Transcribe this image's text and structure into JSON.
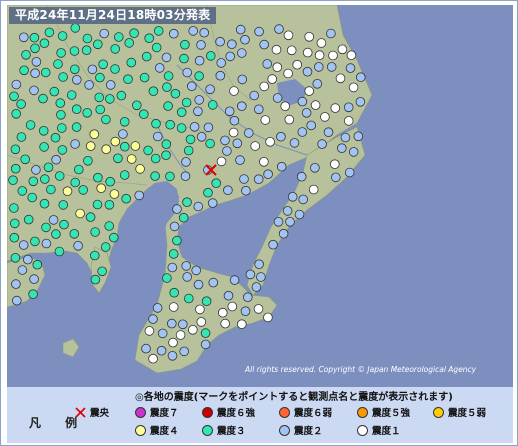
{
  "title": "平成24年11月24日18時03分発表",
  "copyright": "All rights reserved. Copyright © Japan Meteorological Agency",
  "legend": {
    "label": "凡 例",
    "heading": "◎各地の震度(マークをポイントすると観測点名と震度が表示されます)",
    "epicenter": "震央",
    "items": [
      {
        "label": "震度７",
        "color": "#cc33cc"
      },
      {
        "label": "震度６強",
        "color": "#cc0000"
      },
      {
        "label": "震度６弱",
        "color": "#ff6633"
      },
      {
        "label": "震度５強",
        "color": "#ff9900"
      },
      {
        "label": "震度５弱",
        "color": "#ffcc00"
      },
      {
        "label": "震度４",
        "color": "#ffff99"
      },
      {
        "label": "震度３",
        "color": "#33e6b3"
      },
      {
        "label": "震度２",
        "color": "#a3c4f3"
      },
      {
        "label": "震度１",
        "color": "#ffffff"
      }
    ]
  },
  "colors": {
    "sea": "#7c8fbf",
    "land": "#b7c29c",
    "epicenter": "#dd0000"
  }
}
